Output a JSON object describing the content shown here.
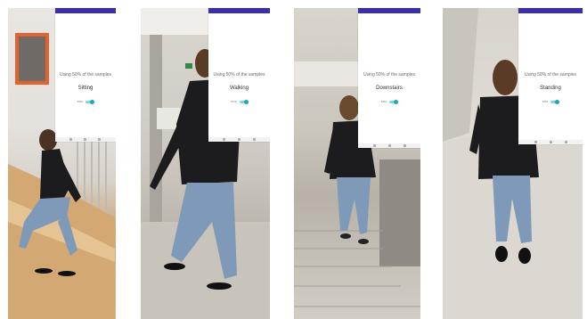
{
  "panels": [
    {
      "status_message": "Using 50% of the samples",
      "activity": "Sitting",
      "toggle_label": "BMR",
      "colors": {
        "status_bar": "#3b2fb0",
        "switch_track": "#7fd6e0",
        "switch_knob": "#1aa7b8"
      }
    },
    {
      "status_message": "Using 50% of the samples",
      "activity": "Walking",
      "toggle_label": "BMR"
    },
    {
      "status_message": "Using 50% of the samples",
      "activity": "Downstairs",
      "toggle_label": "BMR"
    },
    {
      "status_message": "Using 50% of the samples",
      "activity": "Standing",
      "toggle_label": "BMR"
    }
  ]
}
